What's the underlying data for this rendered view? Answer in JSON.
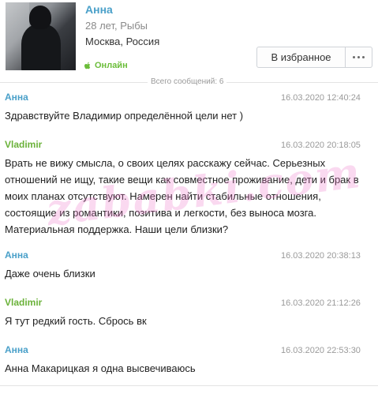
{
  "profile": {
    "name": "Анна",
    "age": "28 лет, Рыбы",
    "location": "Москва, Россия",
    "status": "Онлайн",
    "favorite_label": "В избранное"
  },
  "total_messages": "Всего сообщений: 6",
  "messages": [
    {
      "author": "Анна",
      "time": "16.03.2020 12:40:24",
      "text": "Здравствуйте Владимир определённой цели нет )"
    },
    {
      "author": "Vladimir",
      "time": "16.03.2020 20:18:05",
      "text": "Врать не вижу смысла, о своих целях расскажу сейчас. Серьезных отношений не ищу, такие вещи как совместное проживание, дети и брак в моих планах отсутствуют. Намерен найти стабильные отношения, состоящие из романтики, позитива и легкости, без выноса мозга. Материальная поддержка. Наши цели близки?"
    },
    {
      "author": "Анна",
      "time": "16.03.2020 20:38:13",
      "text": "Даже очень близки"
    },
    {
      "author": "Vladimir",
      "time": "16.03.2020 21:12:26",
      "text": "Я тут редкий гость. Сбрось вк"
    },
    {
      "author": "Анна",
      "time": "16.03.2020 22:53:30",
      "text": "Анна Макарицкая я одна высвечиваюсь"
    }
  ],
  "watermark": "zababki.com",
  "colors": {
    "anna": "#4aa0c9",
    "vladimir": "#6bb23a",
    "online": "#6bbd3a"
  },
  "icons": {
    "status_icon": "apple-icon",
    "more_icon": "more-dots-icon"
  }
}
